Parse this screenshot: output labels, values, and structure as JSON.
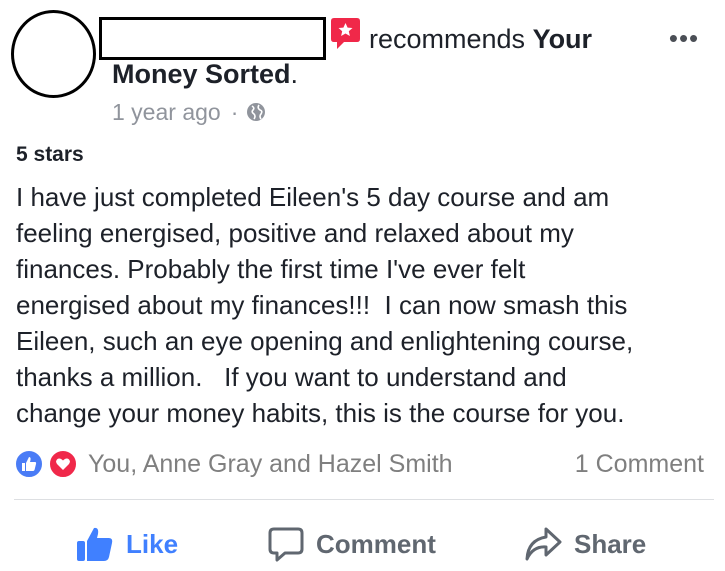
{
  "post": {
    "recommends_text": "recommends ",
    "page_name_part1": "Your",
    "page_name_part2": "Money Sorted",
    "period": ".",
    "timestamp": "1 year ago",
    "separator": "·",
    "privacy_icon": "globe-icon",
    "more_label": "•••",
    "rating": "5 stars",
    "review_lines": [
      "I have just completed Eileen's 5 day course and am",
      "feeling energised, positive and relaxed about my",
      "finances. Probably the first time I've ever felt",
      "energised about my finances!!!  I can now smash this",
      "Eileen, such an eye opening and enlightening course,",
      "thanks a million.   If you want to understand and",
      "change your money habits, this is the course for you."
    ]
  },
  "reactions": {
    "icons": [
      "like-reaction-icon",
      "love-reaction-icon"
    ],
    "names": "You, Anne Gray and Hazel Smith",
    "comment_count": "1 Comment"
  },
  "actions": {
    "like_label": "Like",
    "comment_label": "Comment",
    "share_label": "Share"
  },
  "colors": {
    "like_blue": "#4080ff",
    "love_red": "#f0284a",
    "recommend_badge": "#f02849",
    "meta_gray": "#90949c"
  }
}
